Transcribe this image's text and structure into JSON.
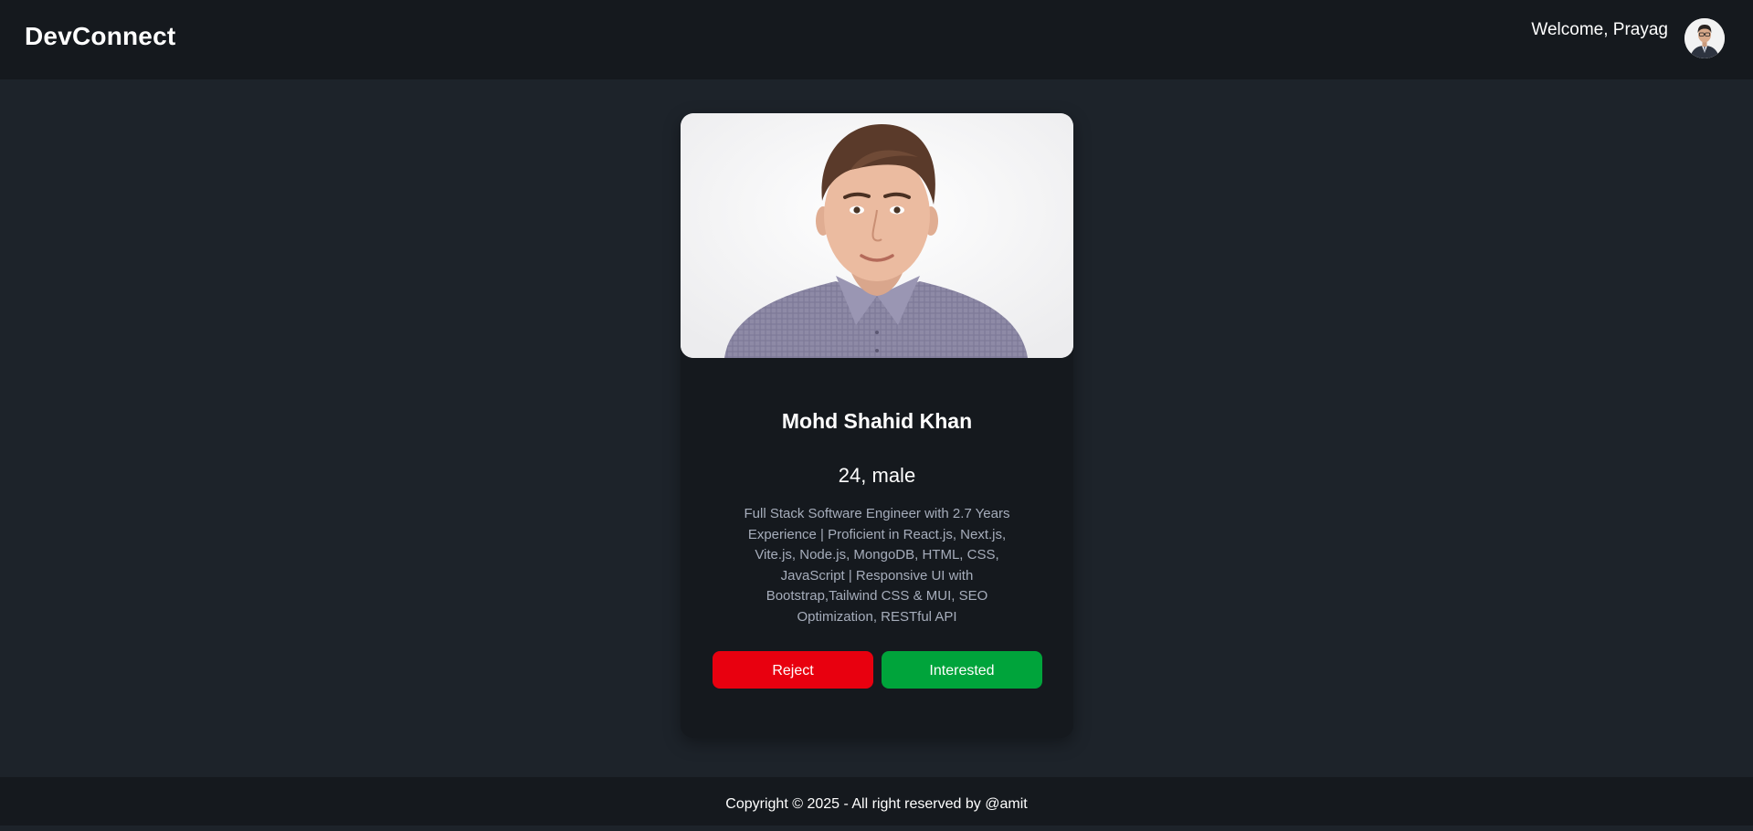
{
  "navbar": {
    "brand": "DevConnect",
    "welcome": "Welcome, Prayag"
  },
  "profile_card": {
    "name": "Mohd Shahid Khan",
    "age_gender": "24, male",
    "about": "Full Stack Software Engineer with 2.7 Years Experience | Proficient in React.js, Next.js, Vite.js, Node.js, MongoDB, HTML, CSS, JavaScript | Responsive UI with Bootstrap,Tailwind CSS & MUI, SEO Optimization, RESTful API",
    "reject_label": "Reject",
    "interested_label": "Interested"
  },
  "footer": {
    "copyright": "Copyright © 2025 - All right reserved by @amit"
  },
  "colors": {
    "page_bg": "#1d232a",
    "bar_bg": "#15191e",
    "reject": "#e8000f",
    "interested": "#00a43b"
  }
}
